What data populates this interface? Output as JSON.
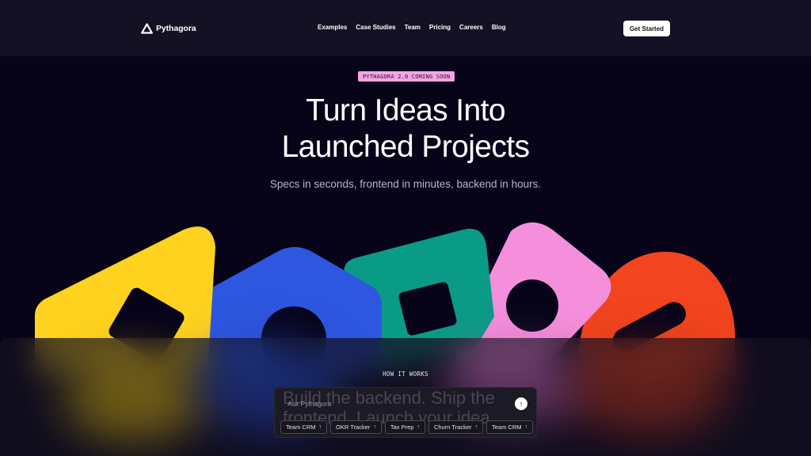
{
  "nav": {
    "brand": "Pythagora",
    "links": [
      "Examples",
      "Case Studies",
      "Team",
      "Pricing",
      "Careers",
      "Blog"
    ],
    "cta": "Get Started"
  },
  "hero": {
    "badge": "PYTHAGORA 2.0 COMING SOON",
    "headline_line1": "Turn Ideas Into",
    "headline_line2": "Launched Projects",
    "subheadline": "Specs in seconds, frontend in minutes, backend in hours."
  },
  "how": {
    "label": "HOW IT WORKS",
    "typewriter": "Build the backend. Ship the frontend. Launch your idea.",
    "placeholder": "Ask Pythagora",
    "send_icon": "arrow-up-icon",
    "chips": [
      "Team CRM",
      "OKR Tracker",
      "Tax Prep",
      "Churn Tracker",
      "Team CRM"
    ]
  },
  "colors": {
    "background": "#07041a",
    "nav": "#141124",
    "badge": "#f7a4e3",
    "yellow": "#ffd21f",
    "blue": "#2e57e0",
    "teal": "#0a9b86",
    "pink": "#f58fdc",
    "red": "#f2441e"
  }
}
